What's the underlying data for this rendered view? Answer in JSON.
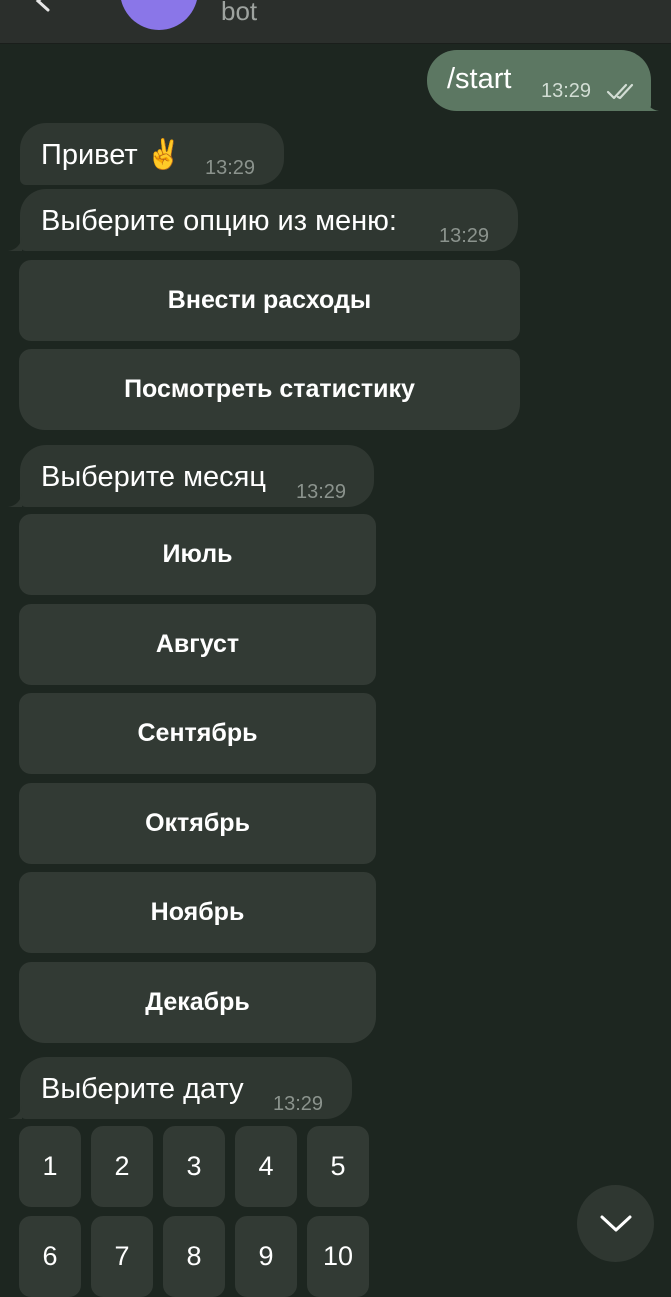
{
  "header": {
    "subtitle": "bot",
    "icons": [
      "back-arrow-icon",
      "avatar",
      "more-vert-icon"
    ],
    "accent": "#8a76e8"
  },
  "messages": {
    "outgoing": {
      "text": "/start",
      "time": "13:29",
      "status": "read-double-check-icon"
    },
    "greeting": {
      "text": "Привет ✌️",
      "time": "13:29"
    },
    "menu_prompt": {
      "text": "Выберите опцию из меню:",
      "time": "13:29"
    },
    "month_prompt": {
      "text": "Выберите месяц",
      "time": "13:29"
    },
    "date_prompt": {
      "text": "Выберите дату",
      "time": "13:29"
    }
  },
  "keyboards": {
    "menu": [
      "Внести расходы",
      "Посмотреть статистику"
    ],
    "months": [
      "Июль",
      "Август",
      "Сентябрь",
      "Октябрь",
      "Ноябрь",
      "Декабрь"
    ],
    "dates_row1": [
      "1",
      "2",
      "3",
      "4",
      "5"
    ],
    "dates_row2": [
      "6",
      "7",
      "8",
      "9",
      "10"
    ]
  },
  "fab": {
    "icon": "chevron-down-icon"
  },
  "colors": {
    "background": "#1d2620",
    "incoming_bubble": "#2f3731",
    "outgoing_bubble": "#5c7762",
    "keyboard_button": "#323a34"
  }
}
